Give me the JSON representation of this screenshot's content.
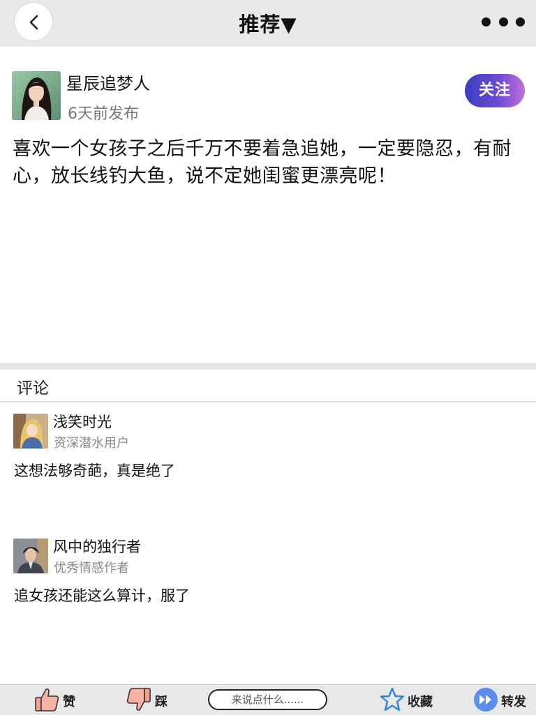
{
  "header": {
    "title": "推荐▼"
  },
  "post": {
    "author": "星辰追梦人",
    "time": "6天前发布",
    "follow_label": "关注",
    "content": "喜欢一个女孩子之后千万不要着急追她，一定要隐忍，有耐心，放长线钓大鱼，说不定她闺蜜更漂亮呢！"
  },
  "comments": {
    "title": "评论",
    "items": [
      {
        "name": "浅笑时光",
        "badge": "资深潜水用户",
        "text": "这想法够奇葩，真是绝了"
      },
      {
        "name": "风中的独行者",
        "badge": "优秀情感作者",
        "text": "追女孩还能这么算计，服了"
      }
    ]
  },
  "bottom_bar": {
    "like_label": "赞",
    "dislike_label": "踩",
    "input_placeholder": "来说点什么......",
    "favorite_label": "收藏",
    "share_label": "转发"
  },
  "colors": {
    "follow_gradient_start": "#3b3fc0",
    "follow_gradient_end": "#c06fd6",
    "star_blue": "#2e86de",
    "share_blue": "#5b8def"
  }
}
